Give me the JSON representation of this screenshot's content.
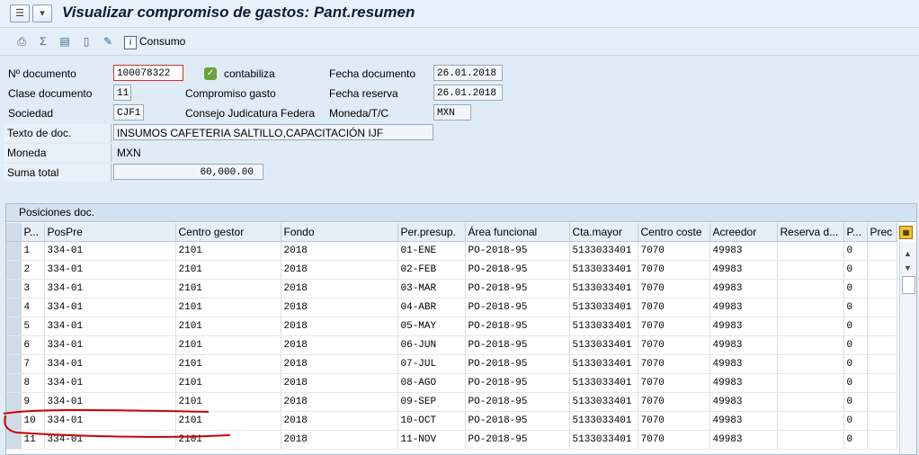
{
  "title": "Visualizar compromiso de gastos: Pant.resumen",
  "toolbar": {
    "icons": [
      "printer-icon",
      "sum-icon",
      "overview-icon",
      "document-icon",
      "edit-icon"
    ],
    "consumo_label": "Consumo"
  },
  "header": {
    "doc_num_label": "Nº documento",
    "doc_num": "100078322",
    "status_text": "contabiliza",
    "fecha_doc_label": "Fecha documento",
    "fecha_doc": "26.01.2018",
    "clase_label": "Clase documento",
    "clase": "11",
    "clase_desc": "Compromiso gasto",
    "fecha_res_label": "Fecha reserva",
    "fecha_res": "26.01.2018",
    "sociedad_label": "Sociedad",
    "sociedad": "CJF1",
    "sociedad_desc": "Consejo Judicatura Federa",
    "moneda_tc_label": "Moneda/T/C",
    "moneda_tc": "MXN",
    "texto_label": "Texto de doc.",
    "texto": "INSUMOS CAFETERIA SALTILLO,CAPACITACIÓN IJF",
    "moneda_label": "Moneda",
    "moneda": "MXN",
    "suma_label": "Suma total",
    "suma": "60,000.00"
  },
  "positions": {
    "title": "Posiciones doc.",
    "columns": [
      "P...",
      "PosPre",
      "Centro gestor",
      "Fondo",
      "Per.presup.",
      "Área funcional",
      "Cta.mayor",
      "Centro coste",
      "Acreedor",
      "Reserva d...",
      "P...",
      "Prec"
    ],
    "rows": [
      [
        "1",
        "334-01",
        "2101",
        "2018",
        "01-ENE",
        "PO-2018-95",
        "5133033401",
        "7070",
        "49983",
        "",
        "0",
        ""
      ],
      [
        "2",
        "334-01",
        "2101",
        "2018",
        "02-FEB",
        "PO-2018-95",
        "5133033401",
        "7070",
        "49983",
        "",
        "0",
        ""
      ],
      [
        "3",
        "334-01",
        "2101",
        "2018",
        "03-MAR",
        "PO-2018-95",
        "5133033401",
        "7070",
        "49983",
        "",
        "0",
        ""
      ],
      [
        "4",
        "334-01",
        "2101",
        "2018",
        "04-ABR",
        "PO-2018-95",
        "5133033401",
        "7070",
        "49983",
        "",
        "0",
        ""
      ],
      [
        "5",
        "334-01",
        "2101",
        "2018",
        "05-MAY",
        "PO-2018-95",
        "5133033401",
        "7070",
        "49983",
        "",
        "0",
        ""
      ],
      [
        "6",
        "334-01",
        "2101",
        "2018",
        "06-JUN",
        "PO-2018-95",
        "5133033401",
        "7070",
        "49983",
        "",
        "0",
        ""
      ],
      [
        "7",
        "334-01",
        "2101",
        "2018",
        "07-JUL",
        "PO-2018-95",
        "5133033401",
        "7070",
        "49983",
        "",
        "0",
        ""
      ],
      [
        "8",
        "334-01",
        "2101",
        "2018",
        "08-AGO",
        "PO-2018-95",
        "5133033401",
        "7070",
        "49983",
        "",
        "0",
        ""
      ],
      [
        "9",
        "334-01",
        "2101",
        "2018",
        "09-SEP",
        "PO-2018-95",
        "5133033401",
        "7070",
        "49983",
        "",
        "0",
        ""
      ],
      [
        "10",
        "334-01",
        "2101",
        "2018",
        "10-OCT",
        "PO-2018-95",
        "5133033401",
        "7070",
        "49983",
        "",
        "0",
        ""
      ],
      [
        "11",
        "334-01",
        "2101",
        "2018",
        "11-NOV",
        "PO-2018-95",
        "5133033401",
        "7070",
        "49983",
        "",
        "0",
        ""
      ]
    ]
  },
  "colors": {
    "annotation": "#cc0000",
    "focus_border": "#cc3333"
  }
}
